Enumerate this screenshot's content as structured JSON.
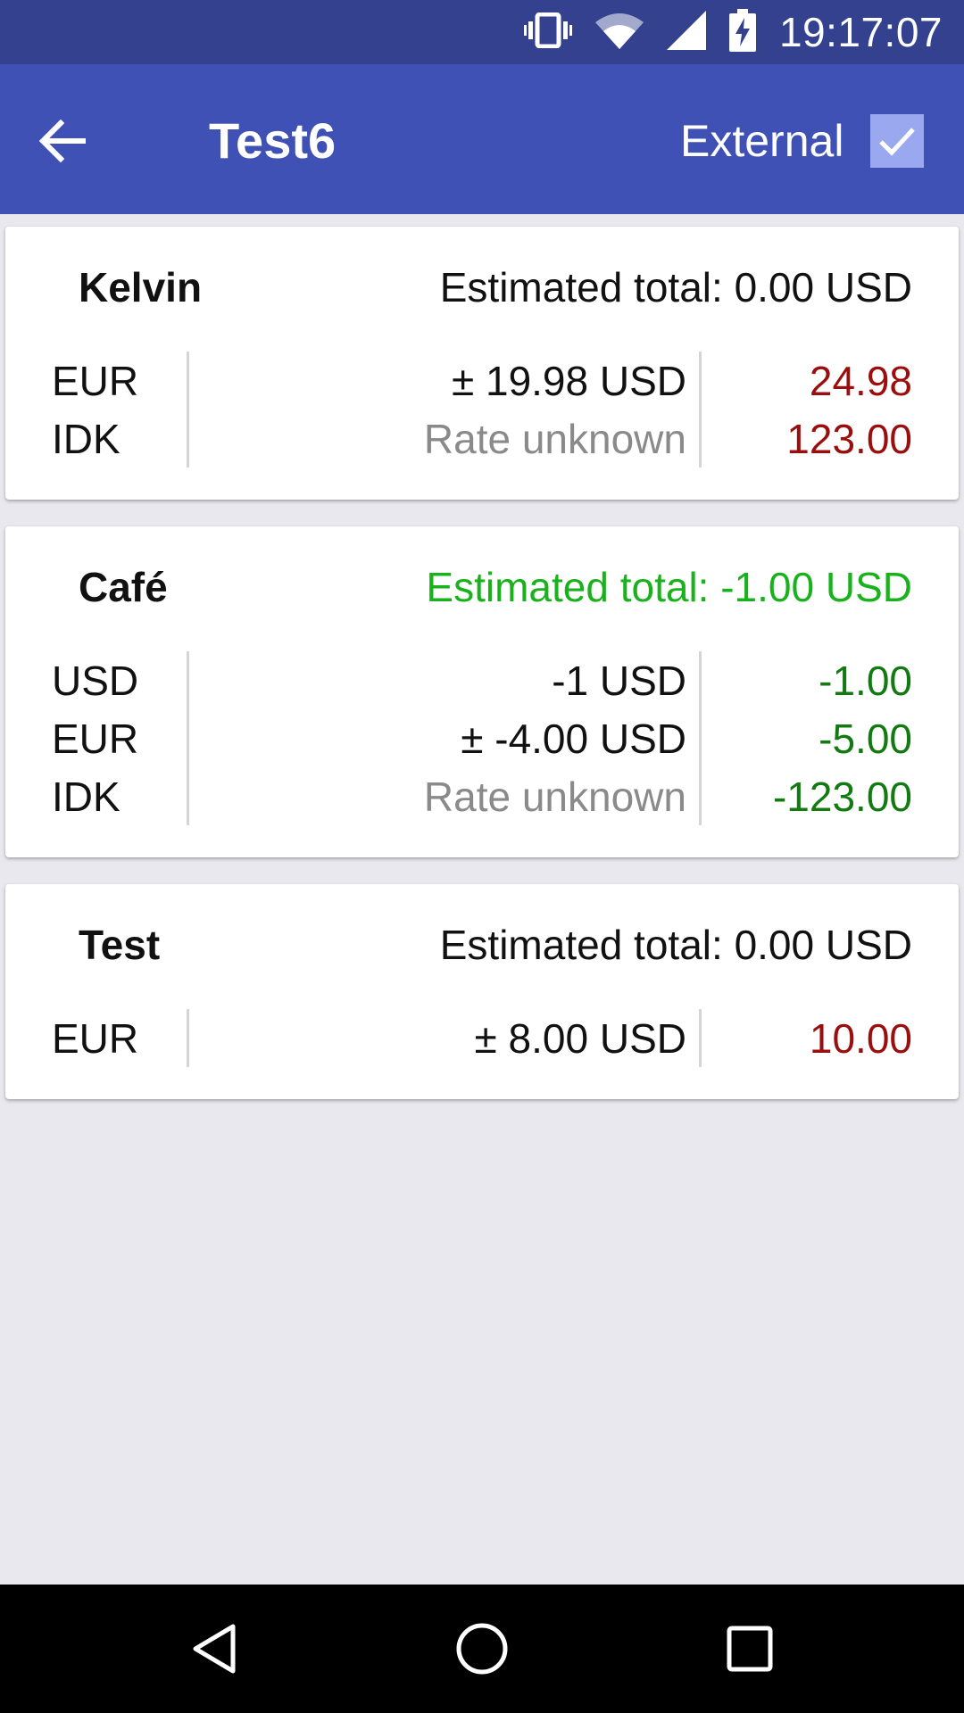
{
  "status_bar": {
    "time": "19:17:07",
    "icons": [
      "vibrate-icon",
      "wifi-icon",
      "signal-icon",
      "battery-charging-icon"
    ]
  },
  "app_bar": {
    "title": "Test6",
    "external_label": "External",
    "external_checked": true,
    "back_icon": "arrow-back-icon"
  },
  "colors": {
    "status_bar": "#33418F",
    "app_bar": "#3F51B5",
    "background": "#E9E8EE",
    "positive_amount": "#9A0E0E",
    "negative_amount": "#137A12",
    "negative_total": "#19B21C",
    "unknown_rate": "#8A8A8A"
  },
  "cards": [
    {
      "name": "Kelvin",
      "estimated_total": "Estimated total: 0.00 USD",
      "total_negative": false,
      "rows": [
        {
          "currency": "EUR",
          "converted": "± 19.98 USD",
          "amount": "24.98",
          "unknown": false,
          "negative": false
        },
        {
          "currency": "IDK",
          "converted": "Rate unknown",
          "amount": "123.00",
          "unknown": true,
          "negative": false
        }
      ]
    },
    {
      "name": "Café",
      "estimated_total": "Estimated total: -1.00 USD",
      "total_negative": true,
      "rows": [
        {
          "currency": "USD",
          "converted": "-1 USD",
          "amount": "-1.00",
          "unknown": false,
          "negative": true
        },
        {
          "currency": "EUR",
          "converted": "± -4.00 USD",
          "amount": "-5.00",
          "unknown": false,
          "negative": true
        },
        {
          "currency": "IDK",
          "converted": "Rate unknown",
          "amount": "-123.00",
          "unknown": true,
          "negative": true
        }
      ]
    },
    {
      "name": "Test",
      "estimated_total": "Estimated total: 0.00 USD",
      "total_negative": false,
      "rows": [
        {
          "currency": "EUR",
          "converted": "± 8.00 USD",
          "amount": "10.00",
          "unknown": false,
          "negative": false
        }
      ]
    }
  ],
  "nav_bar": {
    "icons": [
      "back-triangle-icon",
      "home-circle-icon",
      "recents-square-icon"
    ]
  }
}
